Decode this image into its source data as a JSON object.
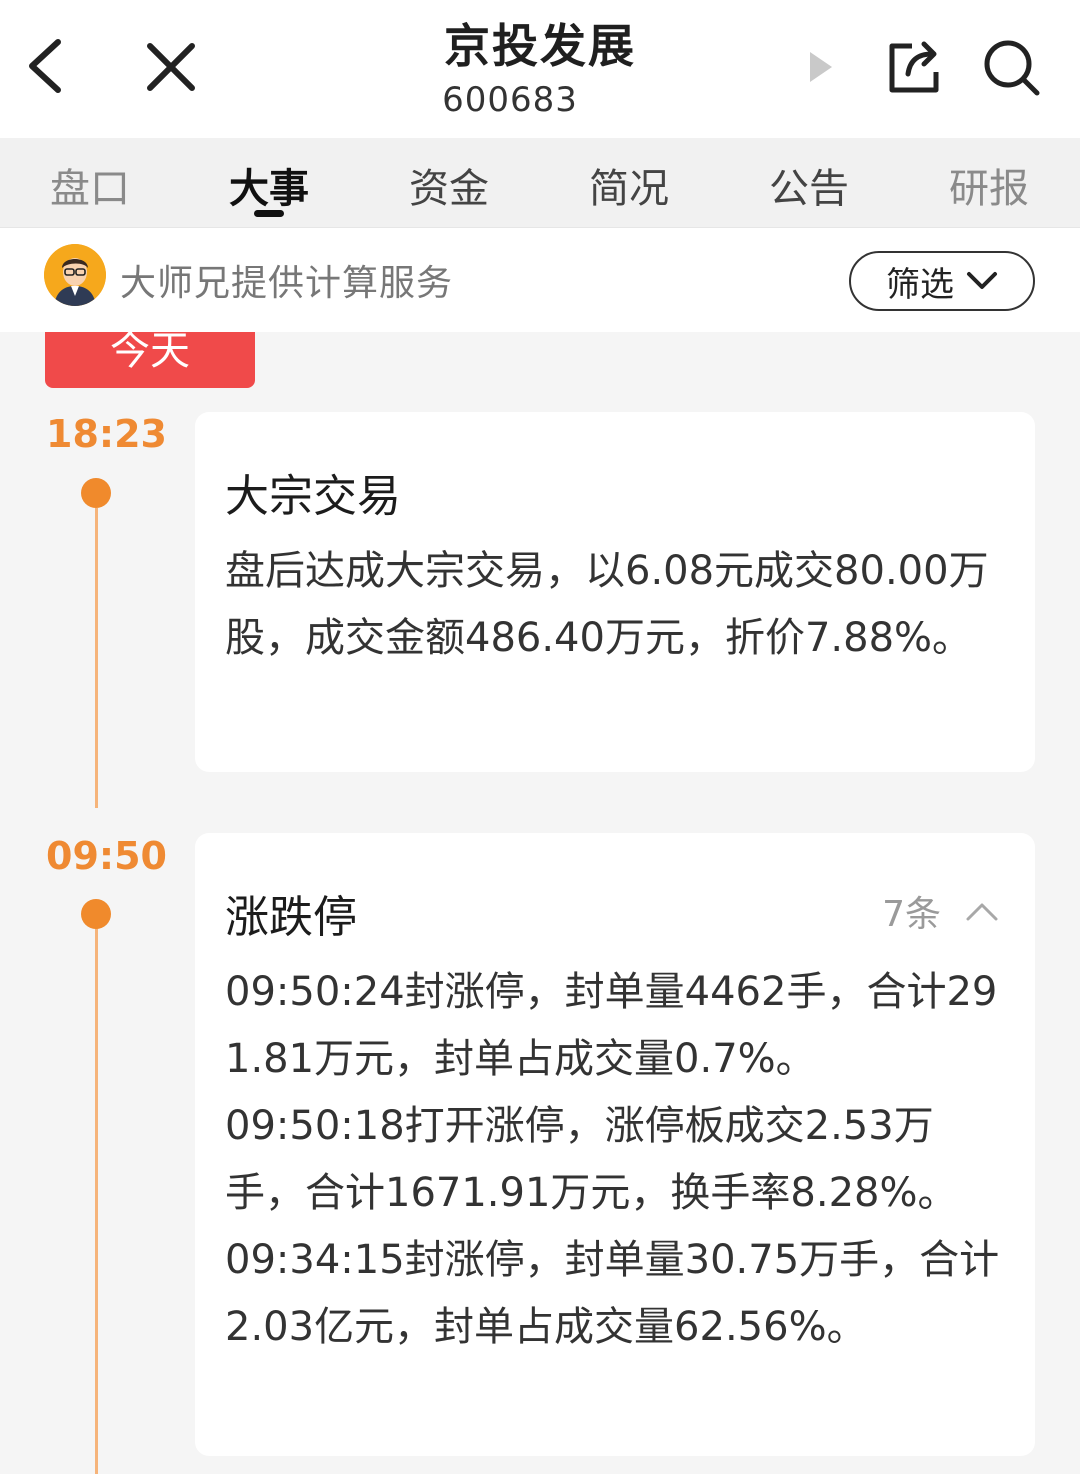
{
  "header": {
    "title": "京投发展",
    "code": "600683"
  },
  "tabs": [
    {
      "label": "盘口",
      "active": false
    },
    {
      "label": "大事",
      "active": true
    },
    {
      "label": "资金",
      "active": false
    },
    {
      "label": "简况",
      "active": false
    },
    {
      "label": "公告",
      "active": false
    },
    {
      "label": "研报",
      "active": false
    }
  ],
  "service": {
    "text": "大师兄提供计算服务",
    "filter_label": "筛选"
  },
  "today_label": "今天",
  "events": [
    {
      "time": "18:23",
      "title": "大宗交易",
      "body": "盘后达成大宗交易，以6.08元成交80.00万股，成交金额486.40万元，折价7.88%。"
    },
    {
      "time": "09:50",
      "title": "涨跌停",
      "count": "7条",
      "items": [
        "09:50:24封涨停，封单量4462手，合计291.81万元，封单占成交量0.7%。",
        "09:50:18打开涨停，涨停板成交2.53万手，合计1671.91万元，换手率8.28%。",
        "09:34:15封涨停，封单量30.75万手，合计2.03亿元，封单占成交量62.56%。"
      ]
    }
  ],
  "colors": {
    "accent_orange": "#ef8a33",
    "today_red": "#f04a4a",
    "timeline": "#f6b47a"
  }
}
